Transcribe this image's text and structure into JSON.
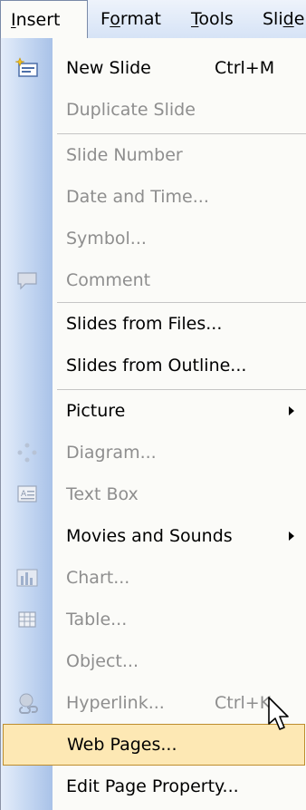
{
  "menubar": {
    "items": [
      {
        "label": "Insert",
        "mnemonic": "I",
        "rest": "nsert",
        "active": true
      },
      {
        "label": "Format",
        "mnemonic": "o",
        "pre": "F",
        "rest": "rmat"
      },
      {
        "label": "Tools",
        "mnemonic": "T",
        "rest": "ools"
      },
      {
        "label": "Slide",
        "pre": "Sli",
        "mnemonic": "d",
        "rest": "e"
      }
    ]
  },
  "menu": {
    "items": [
      {
        "label": "New Slide",
        "shortcut": "Ctrl+M",
        "enabled": true,
        "icon": "new-slide-icon"
      },
      {
        "label": "Duplicate Slide",
        "enabled": false
      },
      {
        "label": "Slide Number",
        "enabled": false
      },
      {
        "label": "Date and Time...",
        "enabled": false
      },
      {
        "label": "Symbol...",
        "enabled": false
      },
      {
        "label": "Comment",
        "enabled": false,
        "icon": "comment-icon"
      },
      {
        "label": "Slides from Files...",
        "enabled": true
      },
      {
        "label": "Slides from Outline...",
        "enabled": true
      },
      {
        "label": "Picture",
        "enabled": true,
        "submenu": true
      },
      {
        "label": "Diagram...",
        "enabled": false,
        "icon": "diagram-icon"
      },
      {
        "label": "Text Box",
        "enabled": false,
        "icon": "text-box-icon"
      },
      {
        "label": "Movies and Sounds",
        "enabled": true,
        "submenu": true
      },
      {
        "label": "Chart...",
        "enabled": false,
        "icon": "chart-icon"
      },
      {
        "label": "Table...",
        "enabled": false,
        "icon": "table-icon"
      },
      {
        "label": "Object...",
        "enabled": false
      },
      {
        "label": "Hyperlink...",
        "shortcut": "Ctrl+K",
        "enabled": false,
        "icon": "hyperlink-icon"
      },
      {
        "label": "Web Pages...",
        "enabled": true,
        "highlighted": true
      },
      {
        "label": "Edit Page Property...",
        "enabled": true
      }
    ]
  },
  "colors": {
    "highlight_bg": "#fde8b4",
    "highlight_border": "#bd8d2e",
    "disabled_text": "#8e8e8e",
    "gutter": "#c3d6f1"
  }
}
